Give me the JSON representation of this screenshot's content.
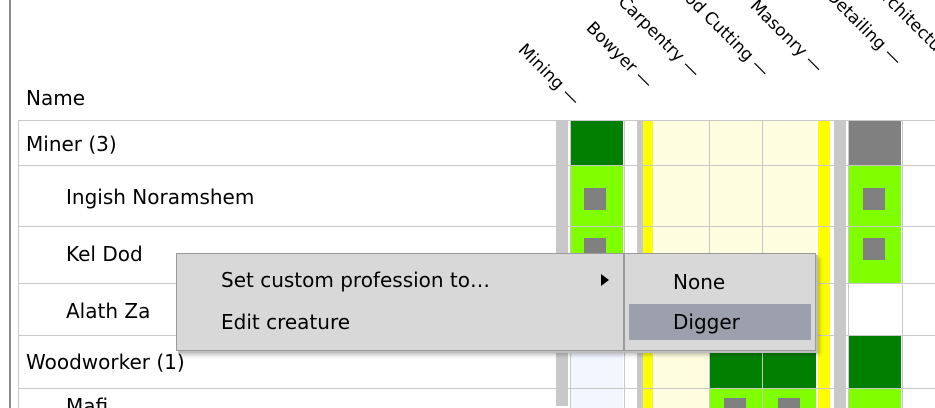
{
  "header": {
    "name_label": "Name"
  },
  "columns": [
    {
      "label": "Mining —"
    },
    {
      "label": "Bowyer —"
    },
    {
      "label": "Carpentry —"
    },
    {
      "label": "Wood Cutting —"
    },
    {
      "label": "Masonry —"
    },
    {
      "label": "Detailing —"
    },
    {
      "label": "Architecture —"
    }
  ],
  "rows": [
    {
      "label": "Miner (3)"
    },
    {
      "label": "Ingish Noramshem"
    },
    {
      "label": "Kel Dod"
    },
    {
      "label": "Alath Za"
    },
    {
      "label": "Woodworker (1)"
    },
    {
      "label": "Mafi"
    }
  ],
  "context_menu": {
    "items": [
      {
        "label": "Set custom profession to…"
      },
      {
        "label": "Edit creature"
      }
    ]
  },
  "submenu": {
    "items": [
      {
        "label": "None"
      },
      {
        "label": "Digger",
        "selected": true
      }
    ]
  },
  "colors": {
    "dark_green": "#007f00",
    "light_green": "#7fff00",
    "yellow": "#ffff00",
    "cream": "#fffde0",
    "gray": "#808080"
  }
}
